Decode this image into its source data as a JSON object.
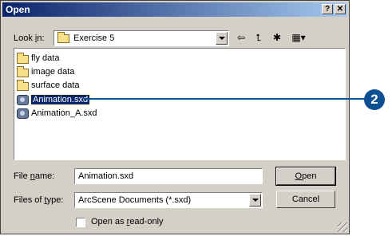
{
  "dialog": {
    "title": "Open",
    "help_button": "?",
    "close_button": "✕"
  },
  "look_in": {
    "label_prefix": "Look ",
    "label_mnemonic": "i",
    "label_suffix": "n:",
    "value": "Exercise 5"
  },
  "toolbar": {
    "back_icon": "back-arrow-icon",
    "up_icon": "up-folder-icon",
    "new_folder_icon": "new-folder-icon",
    "views_icon": "views-menu-icon"
  },
  "file_list": {
    "items": [
      {
        "label": "fly data",
        "type": "folder"
      },
      {
        "label": "image data",
        "type": "folder"
      },
      {
        "label": "surface data",
        "type": "folder"
      },
      {
        "label": "Animation.sxd",
        "type": "sxd",
        "selected": true
      },
      {
        "label": "Animation_A.sxd",
        "type": "sxd"
      }
    ]
  },
  "file_name": {
    "label_prefix": "File ",
    "label_mnemonic": "n",
    "label_suffix": "ame:",
    "value": "Animation.sxd"
  },
  "files_of_type": {
    "label_prefix": "Files of ",
    "label_mnemonic": "t",
    "label_suffix": "ype:",
    "value": "ArcScene Documents (*.sxd)"
  },
  "buttons": {
    "open_mnemonic": "O",
    "open_rest": "pen",
    "cancel": "Cancel"
  },
  "read_only": {
    "label_prefix": "Open as ",
    "label_mnemonic": "r",
    "label_suffix": "ead-only",
    "checked": false
  },
  "callout": {
    "number": "2",
    "color": "#0c4f93"
  }
}
